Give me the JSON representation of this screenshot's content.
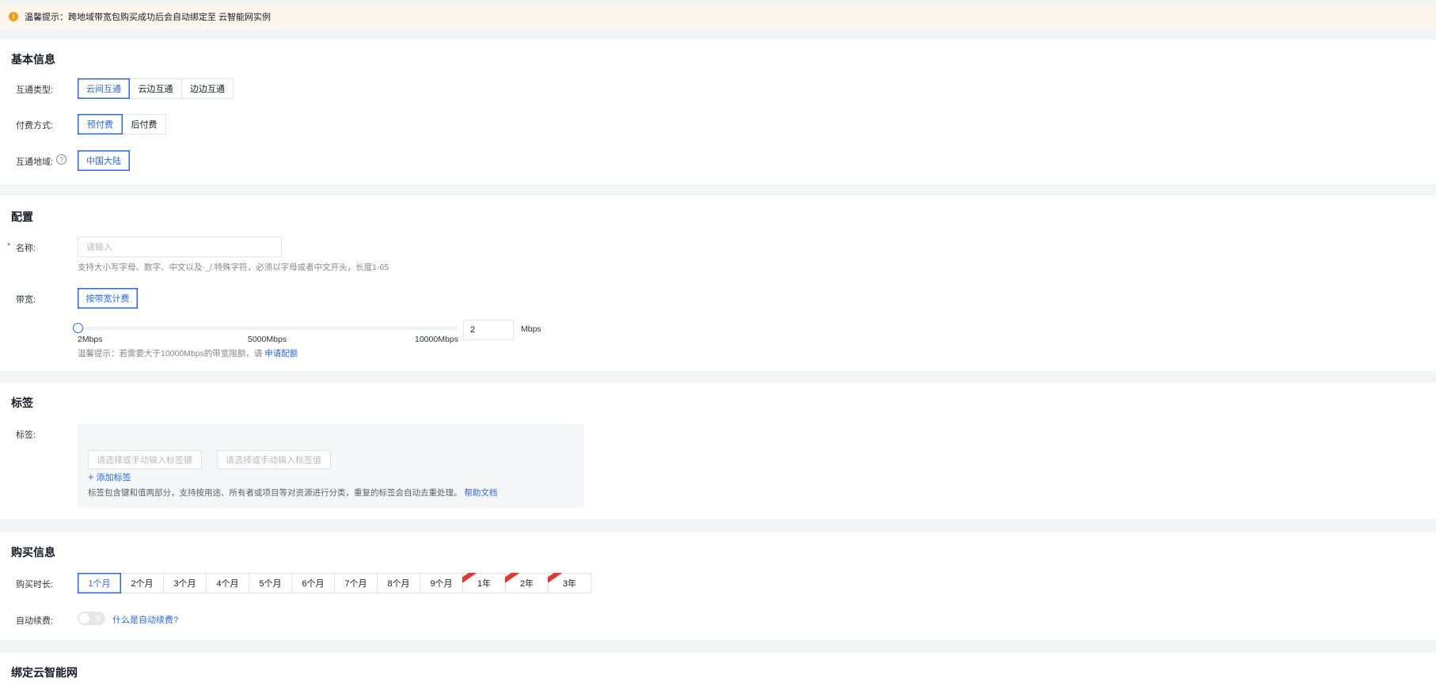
{
  "notice": {
    "text": "温馨提示：跨地域带宽包购买成功后会自动绑定至 云智能网实例"
  },
  "basic": {
    "title": "基本信息",
    "type_label": "互通类型:",
    "type_options": [
      "云间互通",
      "云边互通",
      "边边互通"
    ],
    "pay_label": "付费方式:",
    "pay_options": [
      "预付费",
      "后付费"
    ],
    "region_label": "互通地域:",
    "region_option": "中国大陆",
    "help_glyph": "?"
  },
  "config": {
    "title": "配置",
    "required_mark": "*",
    "name_label": "名称:",
    "name_placeholder": "请输入",
    "name_hint": "支持大小写字母、数字、中文以及-_/.特殊字符，必须以字母或者中文开头，长度1-65",
    "bandwidth_label": "带宽:",
    "bandwidth_option": "按带宽计费",
    "slider": {
      "min_label": "2Mbps",
      "mid_label": "5000Mbps",
      "max_label": "10000Mbps",
      "value": "2",
      "unit": "Mbps",
      "fraction": 0
    },
    "quota_hint": "温馨提示：若需要大于10000Mbps的带宽限额，请",
    "quota_link": "申请配额"
  },
  "tags": {
    "title": "标签",
    "label": "标签:",
    "key_placeholder": "请选择或手动输入标签键",
    "value_placeholder": "请选择或手动输入标签值",
    "add_label": "添加标签",
    "hint": "标签包含键和值两部分，支持按用途、所有者或项目等对资源进行分类，重复的标签会自动去重处理。",
    "doc_link": "帮助文档"
  },
  "purchase": {
    "title": "购买信息",
    "duration_label": "购买时长:",
    "durations": [
      "1个月",
      "2个月",
      "3个月",
      "4个月",
      "5个月",
      "6个月",
      "7个月",
      "8个月",
      "9个月",
      "1年",
      "2年",
      "3年"
    ],
    "auto_renew_label": "自动续费:",
    "toggle_text": "关",
    "auto_renew_link": "什么是自动续费?"
  },
  "bind": {
    "title": "绑定云智能网"
  },
  "colors": {
    "accent": "#2468f2",
    "warning": "#f39c12",
    "ribbon": "#e8352e"
  }
}
